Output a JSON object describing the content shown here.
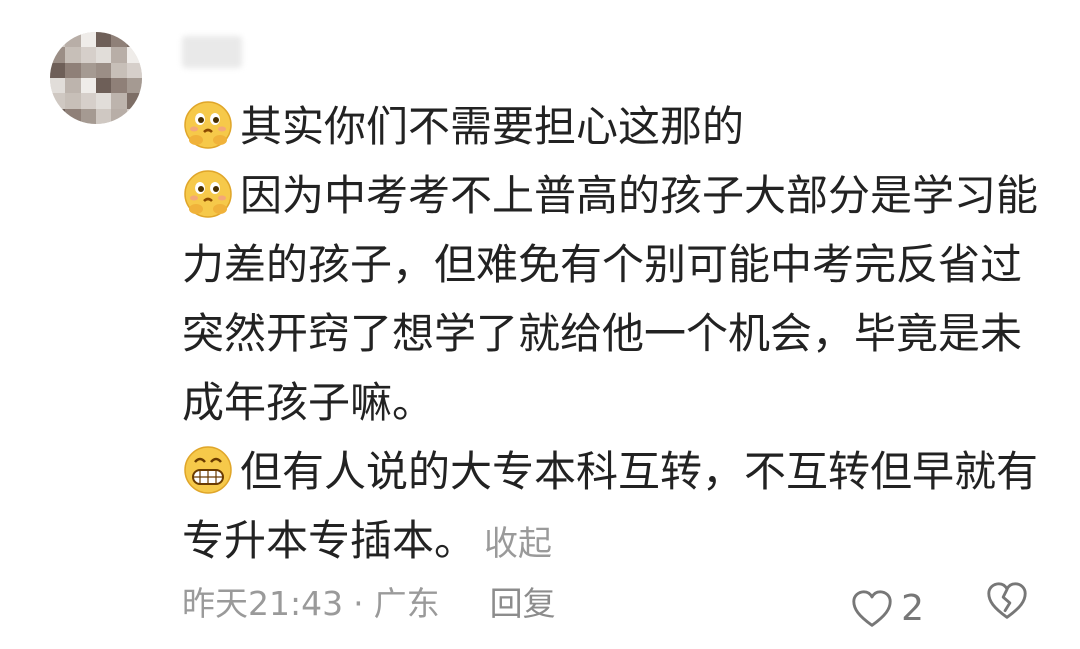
{
  "comment": {
    "paragraphs": [
      {
        "emoji": "smirk-emoji-icon",
        "text": "其实你们不需要担心这那的"
      },
      {
        "emoji": "smirk-emoji-icon",
        "text": "因为中考考不上普高的孩子大部分是学习能力差的孩子，但难免有个别可能中考完反省过突然开窍了想学了就给他一个机会，毕竟是未成年孩子嘛。"
      },
      {
        "emoji": "grin-emoji-icon",
        "text": "但有人说的大专本科互转，不互转但早就有专升本专插本。"
      }
    ],
    "collapse_label": "收起",
    "timestamp": "昨天21:43",
    "separator": "·",
    "location": "广东",
    "reply_label": "回复",
    "like_count": "2"
  },
  "colors": {
    "text": "#222222",
    "meta": "#9a9a9a",
    "icon": "#777777"
  }
}
